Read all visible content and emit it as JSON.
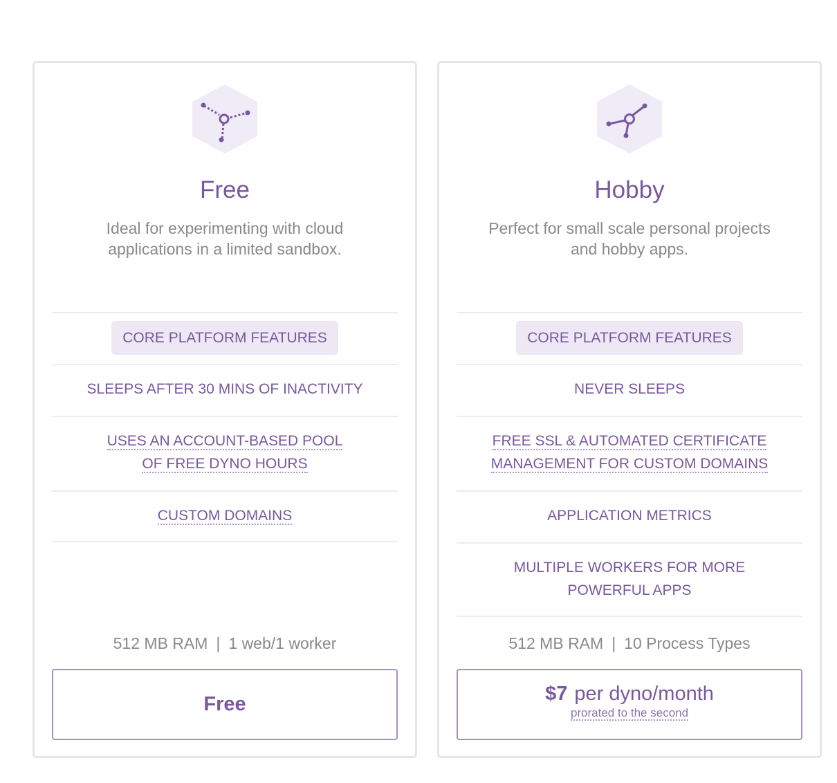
{
  "plans": [
    {
      "title": "Free",
      "description": "Ideal for experimenting with cloud applications in a limited sandbox.",
      "badge": "CORE PLATFORM FEATURES",
      "features": [
        "SLEEPS AFTER 30 MINS OF INACTIVITY",
        "USES AN ACCOUNT-BASED POOL",
        "OF FREE DYNO HOURS",
        "CUSTOM DOMAINS"
      ],
      "specs": {
        "ram": "512 MB RAM",
        "separator": "|",
        "processes": "1 web/1 worker"
      },
      "price": {
        "label": "Free"
      }
    },
    {
      "title": "Hobby",
      "description": "Perfect for small scale personal projects and hobby apps.",
      "badge": "CORE PLATFORM FEATURES",
      "features": [
        "NEVER SLEEPS",
        "FREE SSL & AUTOMATED CERTIFICATE",
        "MANAGEMENT FOR CUSTOM DOMAINS",
        "APPLICATION METRICS",
        "MULTIPLE WORKERS FOR MORE",
        "POWERFUL APPS"
      ],
      "specs": {
        "ram": "512 MB RAM",
        "separator": "|",
        "processes": "10 Process Types"
      },
      "price": {
        "amount": "$7",
        "unit": "per dyno/month",
        "note": "prorated to the second"
      }
    }
  ],
  "icons": {
    "free": "dyno-free-hex-icon",
    "hobby": "dyno-hobby-hex-icon"
  },
  "colors": {
    "accent": "#79589f",
    "badge_bg": "#ede8f4",
    "hex_bg": "#efebf7",
    "muted": "#8a8a8a"
  }
}
